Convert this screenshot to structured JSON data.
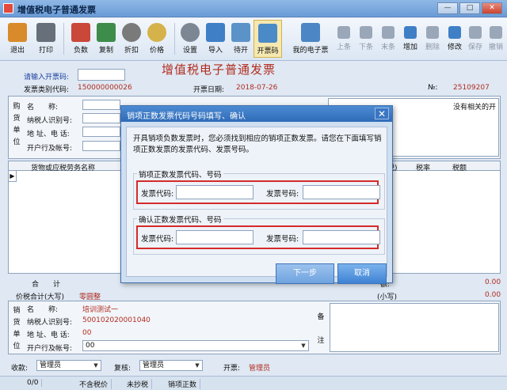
{
  "window": {
    "title": "增值税电子普通发票",
    "min": "—",
    "max": "□",
    "close": "✕"
  },
  "toolbar": {
    "items": [
      {
        "label": "退出",
        "icon": "exit-icon",
        "color": "#d98a2b"
      },
      {
        "label": "打印",
        "icon": "printer-icon",
        "color": "#666f7a"
      },
      {
        "label": "负数",
        "icon": "negative-icon",
        "color": "#c9483a"
      },
      {
        "label": "复制",
        "icon": "copy-icon",
        "color": "#3e8c4a"
      },
      {
        "label": "折扣",
        "icon": "discount-icon",
        "color": "#7a7a7a"
      },
      {
        "label": "价格",
        "icon": "price-icon",
        "color": "#d6b24a"
      },
      {
        "label": "设置",
        "icon": "gear-icon",
        "color": "#7d8794"
      },
      {
        "label": "导入",
        "icon": "import-icon",
        "color": "#3f7fc6"
      },
      {
        "label": "待开",
        "icon": "pending-icon",
        "color": "#5b93c9"
      },
      {
        "label": "开票码",
        "icon": "invoice-code-icon",
        "color": "#4a8ac7"
      },
      {
        "label": "我的电子票",
        "icon": "folder-icon",
        "color": "#4c86c4"
      },
      {
        "label": "上条",
        "icon": "arrow-left-icon",
        "color": "#9aa7b8"
      },
      {
        "label": "下条",
        "icon": "arrow-right-icon",
        "color": "#9aa7b8"
      },
      {
        "label": "末条",
        "icon": "arrow-end-icon",
        "color": "#9aa7b8"
      },
      {
        "label": "增加",
        "icon": "plus-icon",
        "color": "#3f7fc6"
      },
      {
        "label": "删除",
        "icon": "minus-icon",
        "color": "#9aa7b8"
      },
      {
        "label": "修改",
        "icon": "edit-icon",
        "color": "#3f7fc6"
      },
      {
        "label": "保存",
        "icon": "check-icon",
        "color": "#9aa7b8"
      },
      {
        "label": "撤销",
        "icon": "undo-icon",
        "color": "#9aa7b8"
      }
    ],
    "invoice_title": "增值税电子普通发票"
  },
  "header": {
    "prompt_label": "请输入开票码:",
    "type_code_label": "发票类别代码:",
    "type_code_value": "150000000026",
    "date_label": "开票日期:",
    "date_value": "2018-07-26",
    "no_label": "№:",
    "no_value": "25109207"
  },
  "buyer": {
    "side_label": [
      "购",
      "货",
      "单",
      "位"
    ],
    "name_label": "名　　称:",
    "tax_label": "纳税人识别号:",
    "addr_label": "地 址、电 话:",
    "bank_label": "开户行及帐号:",
    "right_text": "没有相关的开"
  },
  "grid": {
    "columns": [
      "货物或应税劳务名称",
      "税)",
      "税率",
      "税额"
    ]
  },
  "totals": {
    "sum_label": "合　　计",
    "sum_value": "0.00",
    "sum_value2": "0.00",
    "tax_label": "额:",
    "total_label": "价税合计(大写)",
    "total_value": "零圆整",
    "small_label": "(小写)",
    "small_value": "0.00"
  },
  "seller": {
    "side_label": [
      "销",
      "货",
      "单",
      "位"
    ],
    "name_label": "名　　称:",
    "name_value": "培训测试一",
    "tax_label": "纳税人识别号:",
    "tax_value": "500102020001040",
    "addr_label": "地 址、电 话:",
    "addr_value": "00",
    "bank_label": "开户行及帐号:",
    "bank_value": "00",
    "note_label": [
      "备",
      "注"
    ]
  },
  "bottom": {
    "payee_label": "收款:",
    "payee_value": "管理员",
    "review_label": "复核:",
    "review_value": "管理员",
    "drawer_label": "开票:",
    "drawer_value": "管理员"
  },
  "status": [
    "0/0",
    "不含税价",
    "未抄税",
    "销项正数"
  ],
  "modal": {
    "title": "销项正数发票代码号码填写、确认",
    "close": "✕",
    "description": "开具销项负数发票时，您必须找到相应的销项正数发票。请您在下面填写销项正数发票的发票代码、发票号码。",
    "group1_title": "销项正数发票代码、号码",
    "group2_title": "确认正数发票代码、号码",
    "code_label": "发票代码:",
    "number_label": "发票号码:",
    "next_label": "下一步",
    "cancel_label": "取消"
  }
}
